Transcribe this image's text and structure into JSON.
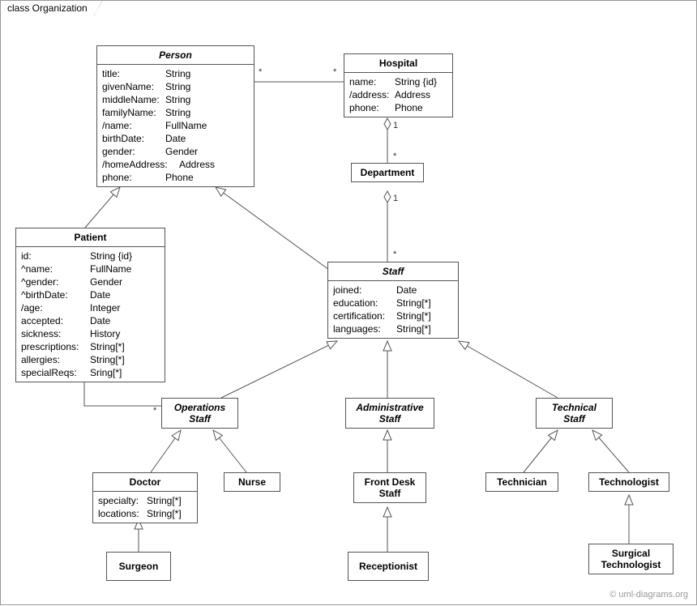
{
  "frame": {
    "title": "class Organization"
  },
  "watermark": "© uml-diagrams.org",
  "classes": {
    "person": {
      "name": "Person",
      "attrs": [
        {
          "name": "title:",
          "type": "String"
        },
        {
          "name": "givenName:",
          "type": "String"
        },
        {
          "name": "middleName:",
          "type": "String"
        },
        {
          "name": "familyName:",
          "type": "String"
        },
        {
          "name": "/name:",
          "type": "FullName"
        },
        {
          "name": "birthDate:",
          "type": "Date"
        },
        {
          "name": "gender:",
          "type": "Gender"
        },
        {
          "name": "/homeAddress:",
          "type": "Address"
        },
        {
          "name": "phone:",
          "type": "Phone"
        }
      ]
    },
    "hospital": {
      "name": "Hospital",
      "attrs": [
        {
          "name": "name:",
          "type": "String {id}"
        },
        {
          "name": "/address:",
          "type": "Address"
        },
        {
          "name": "phone:",
          "type": "Phone"
        }
      ]
    },
    "department": {
      "name": "Department"
    },
    "patient": {
      "name": "Patient",
      "attrs": [
        {
          "name": "id:",
          "type": "String {id}"
        },
        {
          "name": "^name:",
          "type": "FullName"
        },
        {
          "name": "^gender:",
          "type": "Gender"
        },
        {
          "name": "^birthDate:",
          "type": "Date"
        },
        {
          "name": "/age:",
          "type": "Integer"
        },
        {
          "name": "accepted:",
          "type": "Date"
        },
        {
          "name": "sickness:",
          "type": "History"
        },
        {
          "name": "prescriptions:",
          "type": "String[*]"
        },
        {
          "name": "allergies:",
          "type": "String[*]"
        },
        {
          "name": "specialReqs:",
          "type": "Sring[*]"
        }
      ]
    },
    "staff": {
      "name": "Staff",
      "attrs": [
        {
          "name": "joined:",
          "type": "Date"
        },
        {
          "name": "education:",
          "type": "String[*]"
        },
        {
          "name": "certification:",
          "type": "String[*]"
        },
        {
          "name": "languages:",
          "type": "String[*]"
        }
      ]
    },
    "opstaff": {
      "name": "Operations",
      "name2": "Staff"
    },
    "adminstaff": {
      "name": "Administrative",
      "name2": "Staff"
    },
    "techstaff": {
      "name": "Technical",
      "name2": "Staff"
    },
    "doctor": {
      "name": "Doctor",
      "attrs": [
        {
          "name": "specialty:",
          "type": "String[*]"
        },
        {
          "name": "locations:",
          "type": "String[*]"
        }
      ]
    },
    "nurse": {
      "name": "Nurse"
    },
    "frontdesk": {
      "name": "Front Desk",
      "name2": "Staff"
    },
    "technician": {
      "name": "Technician"
    },
    "technologist": {
      "name": "Technologist"
    },
    "surgeon": {
      "name": "Surgeon"
    },
    "receptionist": {
      "name": "Receptionist"
    },
    "surgtech": {
      "name": "Surgical",
      "name2": "Technologist"
    }
  },
  "mult": {
    "m1": "*",
    "m2": "*",
    "m3": "1",
    "m4": "*",
    "m5": "1",
    "m6": "*",
    "m7": "*",
    "m8": "*"
  }
}
